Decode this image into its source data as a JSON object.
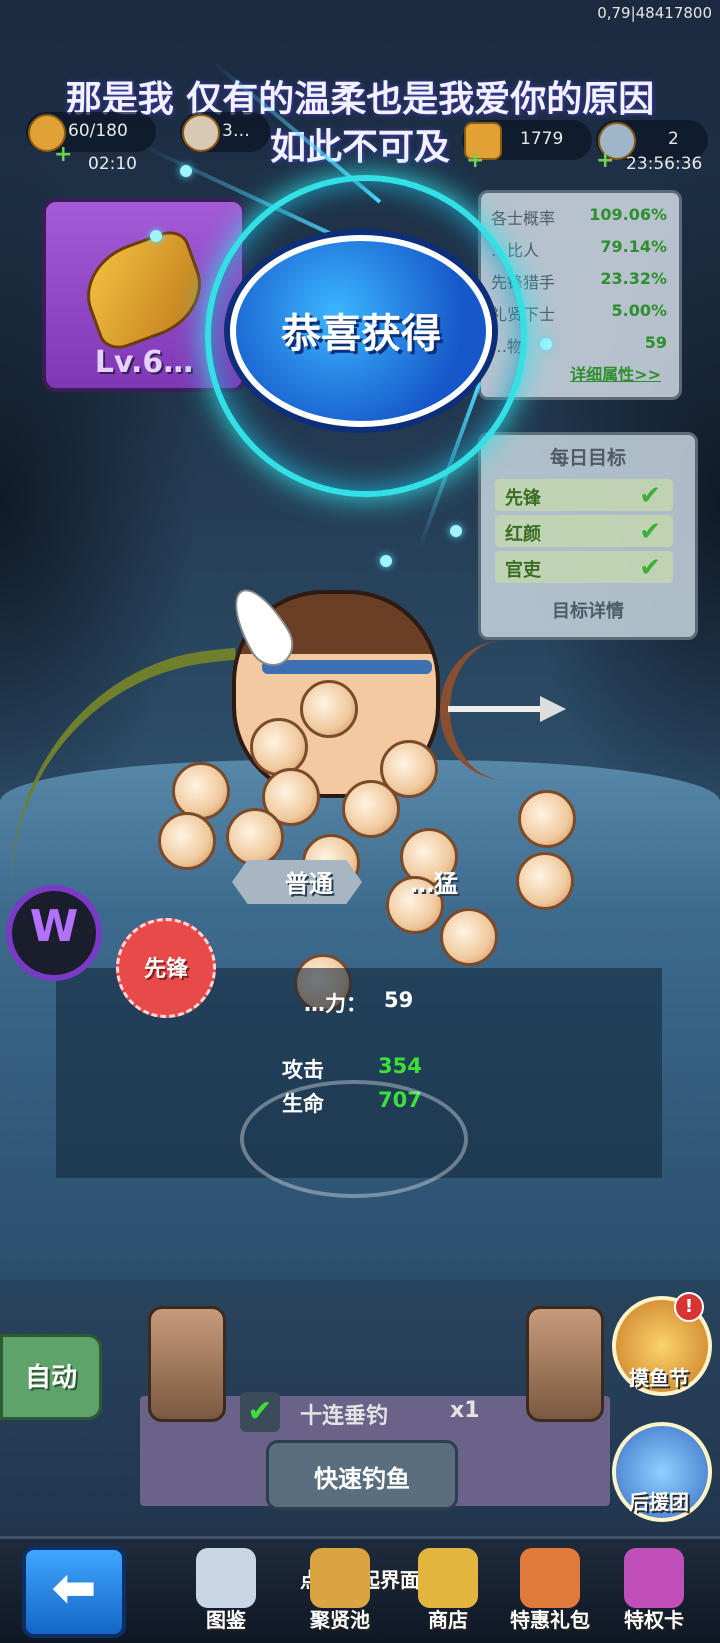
{
  "version": "0,79|48417800",
  "lyric": {
    "line1": "那是我 仅有的温柔也是我爱你的原因",
    "line2": "如此不可及"
  },
  "resources": [
    {
      "icon": "fish-food-icon",
      "value": "60/180",
      "sub": "02:10"
    },
    {
      "icon": "coin-icon",
      "value": "3…",
      "sub": ""
    },
    {
      "icon": "treasure-chest-icon",
      "value": "1779",
      "sub": ""
    },
    {
      "icon": "arrow-ticket-icon",
      "value": "2",
      "sub": "23:56:36"
    }
  ],
  "weapon": {
    "level": "Lv.6…"
  },
  "stats": [
    {
      "name": "各士概率",
      "value": "109.06%"
    },
    {
      "name": "…比人",
      "value": "79.14%"
    },
    {
      "name": "先锋猎手",
      "value": "23.32%"
    },
    {
      "name": "礼贤下士",
      "value": "5.00%"
    },
    {
      "name": "…物",
      "value": "59"
    }
  ],
  "stats_link": "详细属性>>",
  "daily_goals": {
    "title": "每日目标",
    "items": [
      {
        "label": "先锋",
        "done": true
      },
      {
        "label": "红颜",
        "done": true
      },
      {
        "label": "官吏",
        "done": true
      }
    ],
    "details_button": "目标详情"
  },
  "congrats": "恭喜获得",
  "fish": {
    "quality_left": "普通",
    "quality_right": "…猛",
    "role": "先锋",
    "power_label": "…力：",
    "power_value": "59",
    "attack_label": "攻击",
    "attack_value": "354",
    "hp_label": "生命",
    "hp_value": "707"
  },
  "side_buttons": [
    {
      "label": "摸鱼节",
      "badge": "!"
    },
    {
      "label": "后援团",
      "badge": ""
    }
  ],
  "controls": {
    "auto": "自动",
    "ten_cast": "十连垂钓",
    "ten_multiplier": "x1",
    "fast_fish": "快速钓鱼"
  },
  "nav": {
    "collapse_hint": "点击收起界面",
    "items": [
      "图鉴",
      "聚贤池",
      "商店",
      "特惠礼包",
      "特权卡"
    ]
  },
  "accent_colors": {
    "green": "#3ce03a",
    "purple": "#7f37b5",
    "blue": "#1566c7"
  }
}
